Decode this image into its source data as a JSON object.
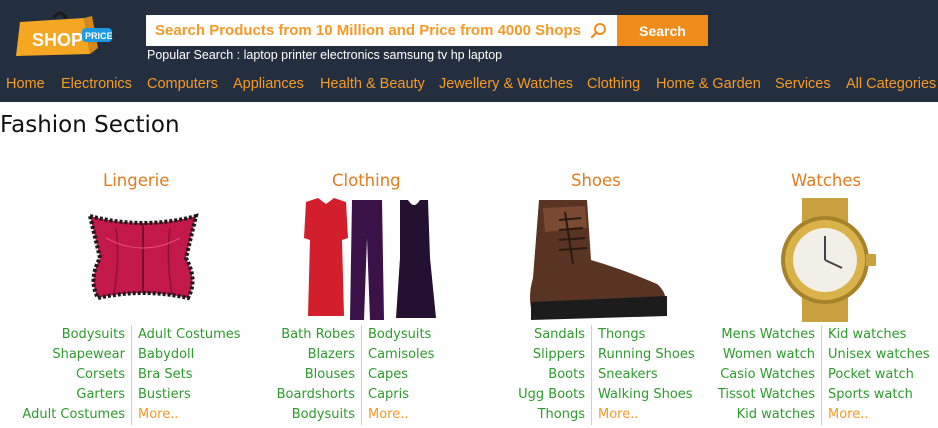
{
  "brand": {
    "logo_main": "SHOP",
    "logo_badge": "PRICE",
    "colors": {
      "header_bg": "#232f3e",
      "accent": "#f59a27",
      "link_green": "#2e9a2e"
    }
  },
  "search": {
    "placeholder": "Search Products from 10 Million and Price from 4000 Shops",
    "button_label": "Search",
    "icon": "search-icon"
  },
  "popular": {
    "label": "Popular Search :",
    "terms": [
      "laptop",
      "printer",
      "electronics",
      "samsung tv",
      "hp laptop"
    ]
  },
  "nav": {
    "items": [
      "Home",
      "Electronics",
      "Computers",
      "Appliances",
      "Health & Beauty",
      "Jewellery & Watches",
      "Clothing",
      "Home & Garden",
      "Services",
      "All Categories"
    ]
  },
  "page_title": "Fashion Section",
  "categories": [
    {
      "title": "Lingerie",
      "image": "corset-image",
      "left": [
        "Bodysuits",
        "Shapewear",
        "Corsets",
        "Garters",
        "Adult Costumes"
      ],
      "right": [
        "Adult Costumes",
        "Babydoll",
        "Bra Sets",
        "Bustiers",
        "More.."
      ]
    },
    {
      "title": "Clothing",
      "image": "clothing-image",
      "left": [
        "Bath Robes",
        "Blazers",
        "Blouses",
        "Boardshorts",
        "Bodysuits"
      ],
      "right": [
        "Bodysuits",
        "Camisoles",
        "Capes",
        "Capris",
        "More.."
      ]
    },
    {
      "title": "Shoes",
      "image": "boot-image",
      "left": [
        "Sandals",
        "Slippers",
        "Boots",
        "Ugg Boots",
        "Thongs"
      ],
      "right": [
        "Thongs",
        "Running Shoes",
        "Sneakers",
        "Walking Shoes",
        "More.."
      ]
    },
    {
      "title": "Watches",
      "image": "watch-image",
      "left": [
        "Mens Watches",
        "Women watch",
        "Casio Watches",
        "Tissot Watches",
        "Kid watches"
      ],
      "right": [
        "Kid watches",
        "Unisex watches",
        "Pocket watch",
        "Sports watch",
        "More.."
      ]
    }
  ]
}
